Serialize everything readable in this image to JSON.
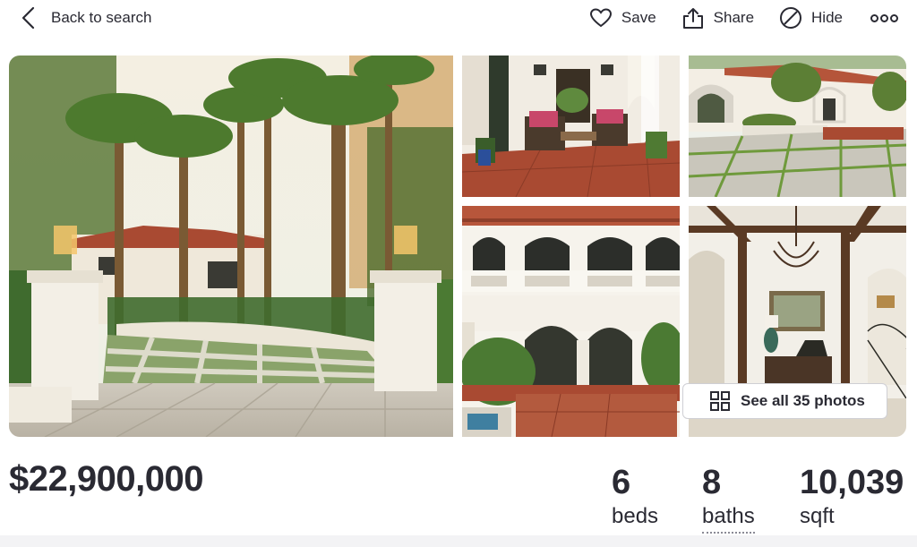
{
  "nav": {
    "back_label": "Back to search",
    "save_label": "Save",
    "share_label": "Share",
    "hide_label": "Hide"
  },
  "gallery": {
    "see_all_label": "See all 35 photos"
  },
  "listing": {
    "price": "$22,900,000",
    "beds_value": "6",
    "beds_label": "beds",
    "baths_value": "8",
    "baths_label": "baths",
    "sqft_value": "10,039",
    "sqft_label": "sqft"
  },
  "colors": {
    "text": "#2a2a33",
    "stucco": "#f2ede4",
    "tile_roof": "#b5553a",
    "terracotta_floor": "#a94a32",
    "foliage": "#3f6b2e"
  }
}
